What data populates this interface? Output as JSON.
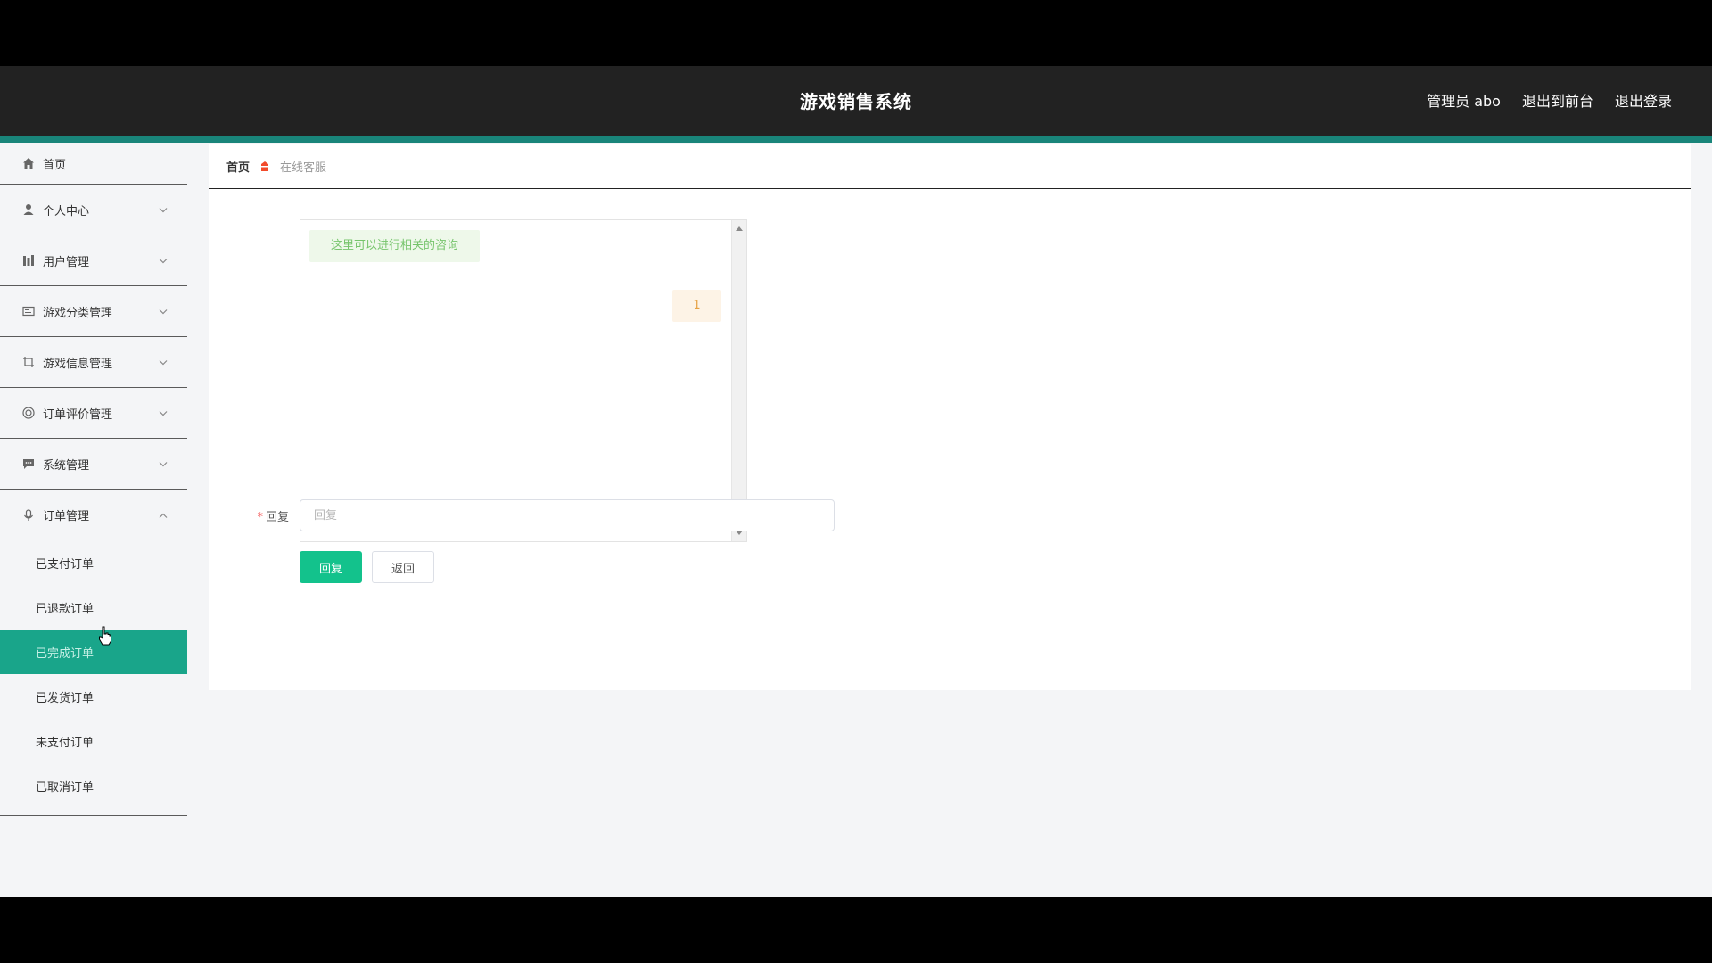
{
  "header": {
    "title": "游戏销售系统",
    "admin": "管理员 abo",
    "to_front": "退出到前台",
    "logout": "退出登录"
  },
  "sidebar": {
    "home": "首页",
    "items": [
      {
        "label": "个人中心",
        "icon": "person-icon"
      },
      {
        "label": "用户管理",
        "icon": "chart-icon"
      },
      {
        "label": "游戏分类管理",
        "icon": "list-card-icon"
      },
      {
        "label": "游戏信息管理",
        "icon": "crop-icon"
      },
      {
        "label": "订单评价管理",
        "icon": "circle-icon"
      },
      {
        "label": "系统管理",
        "icon": "message-icon"
      }
    ],
    "order_group": "订单管理",
    "order_items": [
      "已支付订单",
      "已退款订单",
      "已完成订单",
      "已发货订单",
      "未支付订单",
      "已取消订单"
    ],
    "active_item": "已完成订单"
  },
  "breadcrumb": {
    "home": "首页",
    "current": "在线客服"
  },
  "chat": {
    "messages": [
      {
        "side": "left",
        "text": "这里可以进行相关的咨询"
      },
      {
        "side": "right",
        "text": "1"
      }
    ]
  },
  "form": {
    "reply_label": "回复",
    "reply_placeholder": "回复",
    "reply_value": "",
    "submit": "回复",
    "back": "返回"
  },
  "colors": {
    "accent": "#19a58a",
    "header_bg": "#222222",
    "primary_button": "#13c28c"
  }
}
